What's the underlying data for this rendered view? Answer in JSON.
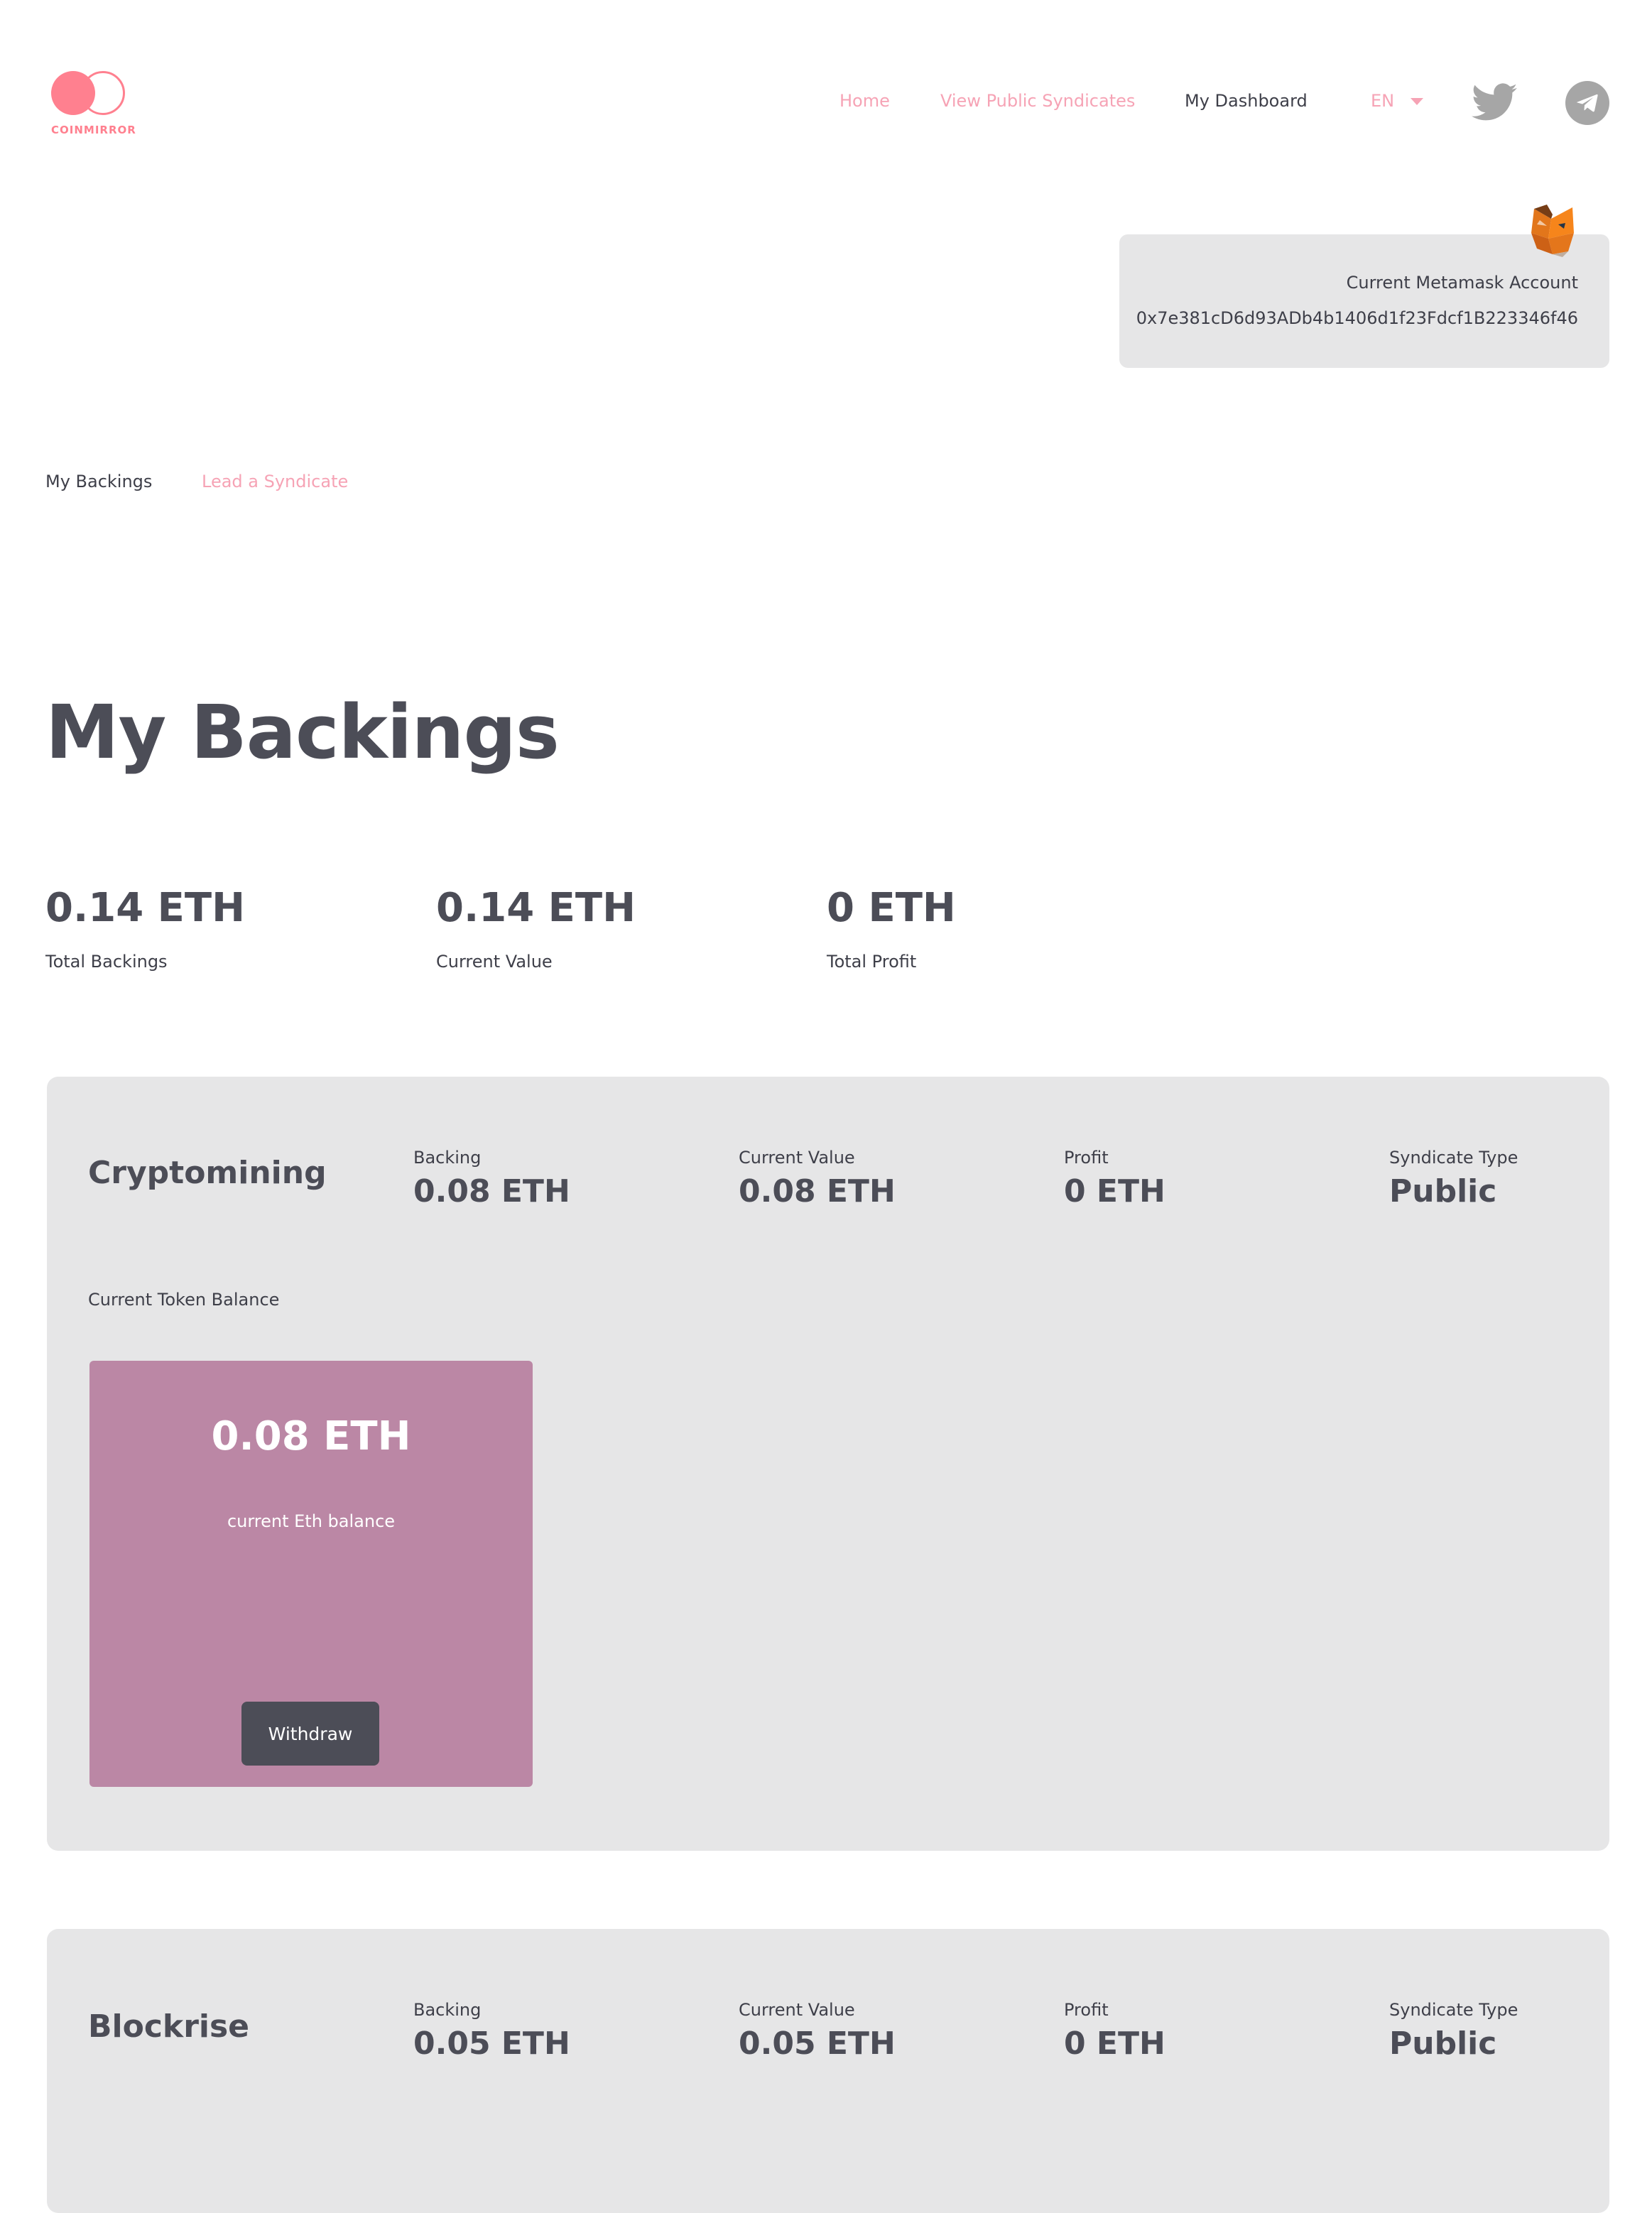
{
  "header": {
    "logo_text": "COINMIRROR",
    "nav": [
      {
        "label": "Home"
      },
      {
        "label": "View Public Syndicates"
      },
      {
        "label": "My Dashboard"
      }
    ],
    "language": "EN",
    "social": [
      "twitter-icon",
      "telegram-icon"
    ]
  },
  "metamask": {
    "label": "Current Metamask Account",
    "address": "0x7e381cD6d93ADb4b1406d1f23Fdcf1B223346f46"
  },
  "subtabs": [
    {
      "label": "My Backings",
      "active": true
    },
    {
      "label": "Lead a Syndicate",
      "active": false
    }
  ],
  "page": {
    "title": "My Backings"
  },
  "summary": [
    {
      "value": "0.14 ETH",
      "label": "Total Backings"
    },
    {
      "value": "0.14 ETH",
      "label": "Current Value"
    },
    {
      "value": "0 ETH",
      "label": "Total Profit"
    }
  ],
  "field_labels": {
    "backing": "Backing",
    "current_value": "Current Value",
    "profit": "Profit",
    "syndicate_type": "Syndicate Type",
    "token_balance": "Current Token Balance"
  },
  "cards": [
    {
      "name": "Cryptomining",
      "backing": "0.08 ETH",
      "current_value": "0.08 ETH",
      "profit": "0 ETH",
      "syndicate_type": "Public",
      "balance": {
        "value": "0.08 ETH",
        "label": "current Eth balance",
        "button": "Withdraw"
      }
    },
    {
      "name": "Blockrise",
      "backing": "0.05 ETH",
      "current_value": "0.05 ETH",
      "profit": "0 ETH",
      "syndicate_type": "Public"
    }
  ],
  "colors": {
    "accent_pink": "#ff808f",
    "nav_pink": "#f6a3b5",
    "text_dark": "#4c4d57",
    "card_bg": "#e6e6e7",
    "balance_bg": "#bb87a5"
  }
}
